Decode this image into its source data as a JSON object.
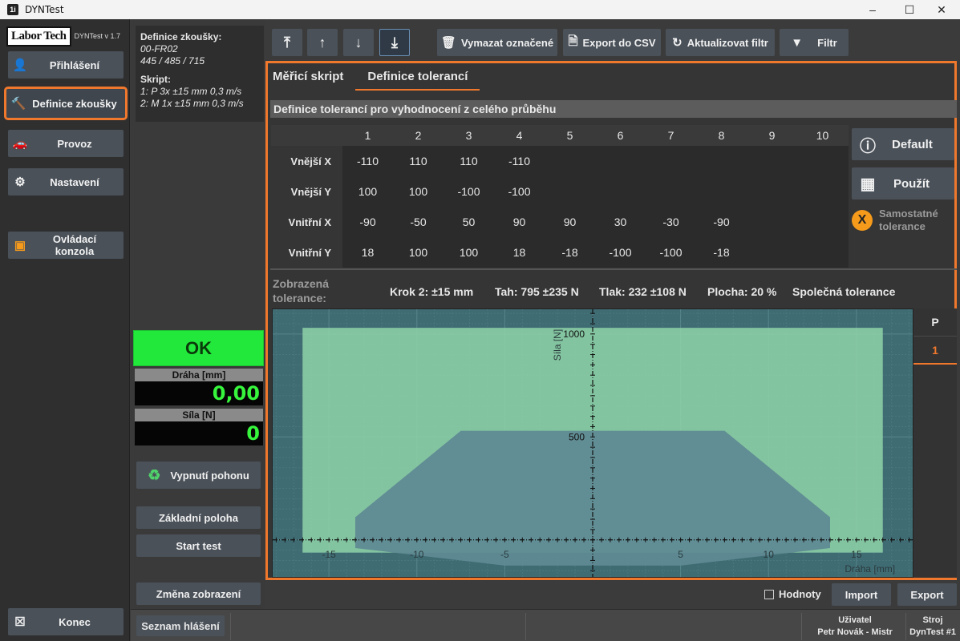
{
  "window": {
    "title": "DYNTest",
    "icon_label": "1i"
  },
  "leftnav": {
    "logo": "Labor Tech",
    "version": "DYNTest v 1.7",
    "items": [
      {
        "label": "Přihlášení",
        "icon": "user-icon"
      },
      {
        "label": "Definice zkoušky",
        "icon": "hammer-icon"
      },
      {
        "label": "Provoz",
        "icon": "car-icon"
      },
      {
        "label": "Nastavení",
        "icon": "gear-icon"
      },
      {
        "label": "Ovládací konzola",
        "icon": "console-icon"
      }
    ],
    "exit_label": "Konec"
  },
  "definition": {
    "title": "Definice zkoušky:",
    "code": "00-FR02",
    "values": "445 / 485 / 715",
    "script_title": "Skript:",
    "script_lines": [
      "1: P  3x  ±15 mm  0,3 m/s",
      "2: M  1x  ±15 mm  0,3 m/s"
    ]
  },
  "status": {
    "ok_label": "OK",
    "ok_color": "#22e83c",
    "draha_label": "Dráha [mm]",
    "draha_value": "0,00",
    "sila_label": "Síla [N]",
    "sila_value": "0"
  },
  "mid_buttons": {
    "vypnuti": "Vypnutí pohonu",
    "zakladni": "Základní poloha",
    "start": "Start test",
    "zmena": "Změna zobrazení"
  },
  "toolbar": {
    "vymazat": "Vymazat označené",
    "export_csv": "Export do CSV",
    "aktualizovat": "Aktualizovat filtr",
    "filtr": "Filtr"
  },
  "tabs": [
    "Měřicí skript",
    "Definice tolerancí"
  ],
  "section_title": "Definice tolerancí pro vyhodnocení z celého průběhu",
  "tolerance_table": {
    "columns": [
      "1",
      "2",
      "3",
      "4",
      "5",
      "6",
      "7",
      "8",
      "9",
      "10"
    ],
    "rows": [
      {
        "label": "Vnější X",
        "values": [
          "-110",
          "110",
          "110",
          "-110",
          "",
          "",
          "",
          "",
          "",
          ""
        ]
      },
      {
        "label": "Vnější Y",
        "values": [
          "100",
          "100",
          "-100",
          "-100",
          "",
          "",
          "",
          "",
          "",
          ""
        ]
      },
      {
        "label": "Vnitřní X",
        "values": [
          "-90",
          "-50",
          "50",
          "90",
          "90",
          "30",
          "-30",
          "-90",
          "",
          ""
        ]
      },
      {
        "label": "Vnitřní Y",
        "values": [
          "18",
          "100",
          "100",
          "18",
          "-18",
          "-100",
          "-100",
          "-18",
          "",
          ""
        ]
      }
    ]
  },
  "right_buttons": {
    "default": "Default",
    "pouzit": "Použít",
    "samostatne_line1": "Samostatné",
    "samostatne_line2": "tolerance",
    "samostatne_mark": "X"
  },
  "displayed": {
    "label_line1": "Zobrazená",
    "label_line2": "tolerance:",
    "krok": "Krok 2:  ±15 mm",
    "tah": "Tah: 795 ±235 N",
    "tlak": "Tlak: 232 ±108 N",
    "plocha": "Plocha: 20 %",
    "spolecna": "Společná tolerance"
  },
  "chart_data": {
    "type": "area",
    "xlabel": "Dráha [mm]",
    "ylabel": "Síla [N]",
    "xlim": [
      -18.2,
      18.2
    ],
    "ylim": [
      -180,
      1120
    ],
    "x_ticks": [
      -15,
      -10,
      -5,
      5,
      10,
      15
    ],
    "y_ticks": [
      500,
      1000
    ],
    "grid": true,
    "outer_band": {
      "x": [
        -16.5,
        16.5
      ],
      "y": [
        -62,
        1030
      ],
      "color": "#8fd3a8"
    },
    "inner_polygon": {
      "x": [
        -13.5,
        -7.5,
        7.5,
        13.5,
        13.5,
        5,
        -5,
        -13.5
      ],
      "y": [
        110,
        530,
        530,
        110,
        -40,
        -125,
        -125,
        -40
      ],
      "color": "#5f8a93"
    }
  },
  "side_panel": {
    "header": "P",
    "item": "1"
  },
  "bottom": {
    "hodnoty": "Hodnoty",
    "import": "Import",
    "export": "Export"
  },
  "statusbar": {
    "seznam": "Seznam hlášení",
    "uzivatel_label": "Uživatel",
    "uzivatel_value": "Petr Novák   -   Mistr",
    "stroj_label": "Stroj",
    "stroj_value": "DynTest #1"
  }
}
